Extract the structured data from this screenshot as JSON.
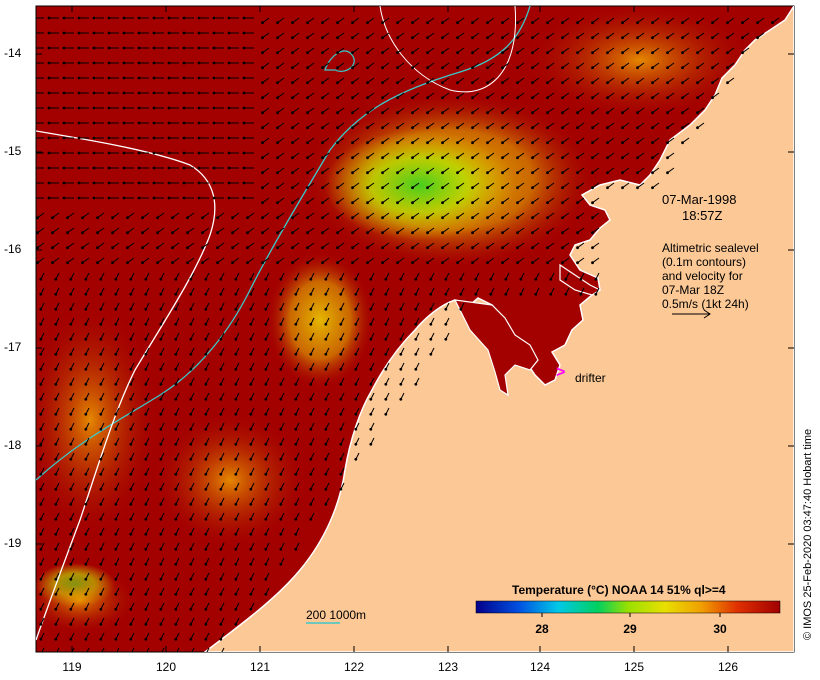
{
  "map": {
    "lat_labels": [
      "-14",
      "-15",
      "-16",
      "-17",
      "-18",
      "-19"
    ],
    "lon_labels": [
      "119",
      "120",
      "121",
      "122",
      "123",
      "124",
      "125",
      "126"
    ],
    "date_line1": "07-Mar-1998",
    "date_line2": "18:57Z",
    "altimetry_lines": [
      "Altimetric sealevel",
      "(0.1m contours)",
      "and velocity for",
      "07-Mar 18Z",
      "0.5m/s (1kt 24h)"
    ],
    "drifter_symbol": ">",
    "drifter_label": "drifter",
    "isobath_label": "200  1000m",
    "colorbar": {
      "title": "Temperature (°C) NOAA 14 51% ql>=4",
      "ticks": [
        "28",
        "29",
        "30"
      ],
      "colors": [
        "#00008b",
        "#0050e0",
        "#00c8e8",
        "#00d060",
        "#9ae000",
        "#e8e000",
        "#f0a000",
        "#e03000",
        "#a00000"
      ]
    },
    "credit": "© IMOS 25-Feb-2020 03:47:40 Hobart time",
    "colors": {
      "land": "#fcc896",
      "warm_ocean": "#a30000",
      "isobath_200": "#3cc8c8",
      "isobath_1000": "#ffffff"
    }
  }
}
